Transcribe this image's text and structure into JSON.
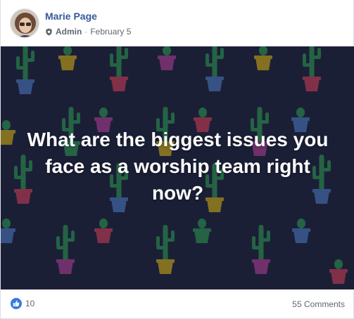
{
  "post": {
    "author": "Marie Page",
    "role": "Admin",
    "separator": "·",
    "date": "February 5",
    "image_text": "What are the biggest issues you face as a worship team right now?",
    "reaction_count": "10",
    "comments_label": "55 Comments"
  },
  "colors": {
    "author_link": "#365899",
    "image_background": "#212642",
    "like_blue": "#3578e5",
    "cactus_green": "#2f8a57"
  },
  "icons": {
    "role": "shield-icon",
    "reaction": "like-icon"
  }
}
